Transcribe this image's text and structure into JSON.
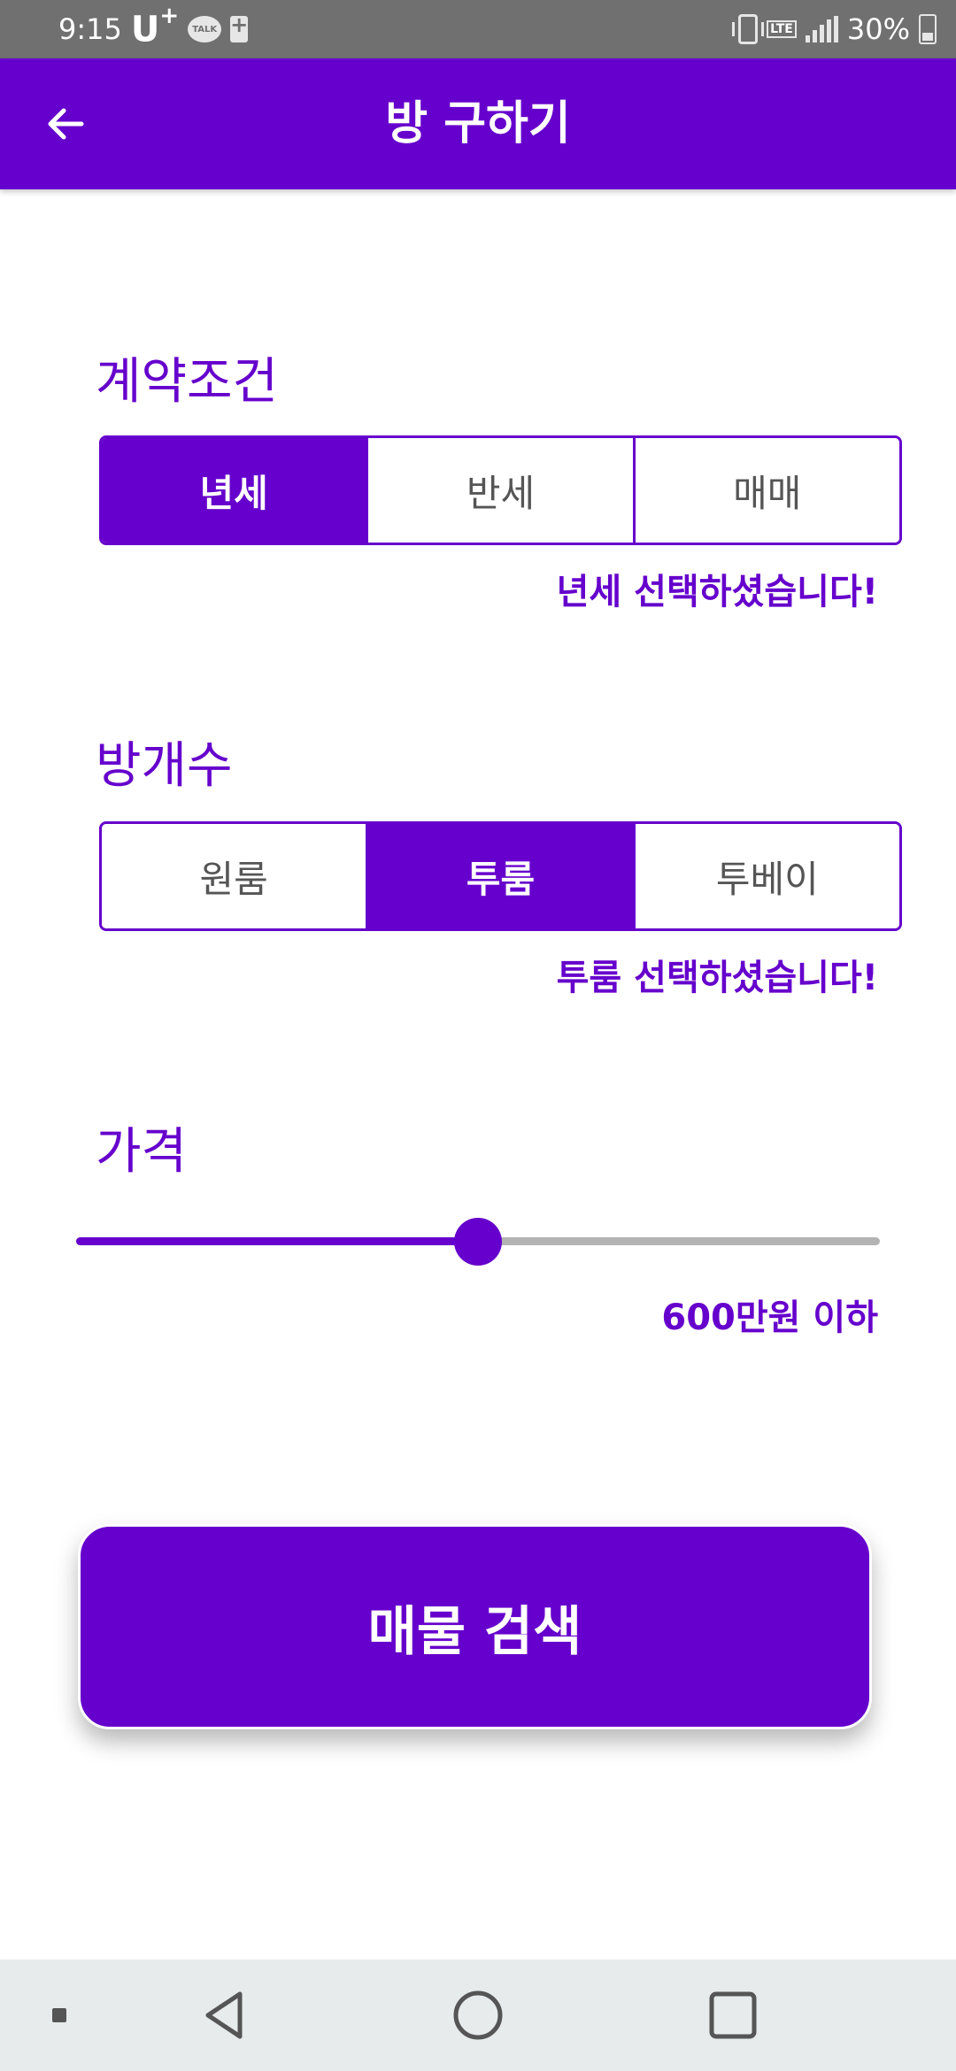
{
  "status_bar": {
    "time": "9:15",
    "carrier": "U",
    "carrier_sup": "+",
    "talk": "TALK",
    "network": "LTE",
    "battery": "30%",
    "icons": [
      "talk-icon",
      "battery-saver-icon",
      "vibrate-icon",
      "lte-icon",
      "signal-icon",
      "battery-icon"
    ]
  },
  "app_bar": {
    "title": "방 구하기",
    "back_icon": "arrow-left-icon",
    "background": "#6600cc"
  },
  "contract": {
    "title": "계약조건",
    "options": [
      "년세",
      "반세",
      "매매"
    ],
    "selected": "년세",
    "feedback": "년세 선택하셨습니다!"
  },
  "rooms": {
    "title": "방개수",
    "options": [
      "원룸",
      "투룸",
      "투베이"
    ],
    "selected": "투룸",
    "feedback": "투룸 선택하셨습니다!"
  },
  "price": {
    "title": "가격",
    "slider_value_fraction": 0.5,
    "label": "600만원 이하"
  },
  "search_button": {
    "label": "매물 검색"
  },
  "nav_bar": {
    "items": [
      "recent-dot-icon",
      "back-triangle-icon",
      "home-circle-icon",
      "recents-square-icon"
    ]
  },
  "colors": {
    "accent": "#6600cc",
    "status_bar": "#707070",
    "nav_bar": "#e7ebec",
    "slider_inactive": "#b3b3b3",
    "unselected_text": "#555555"
  }
}
